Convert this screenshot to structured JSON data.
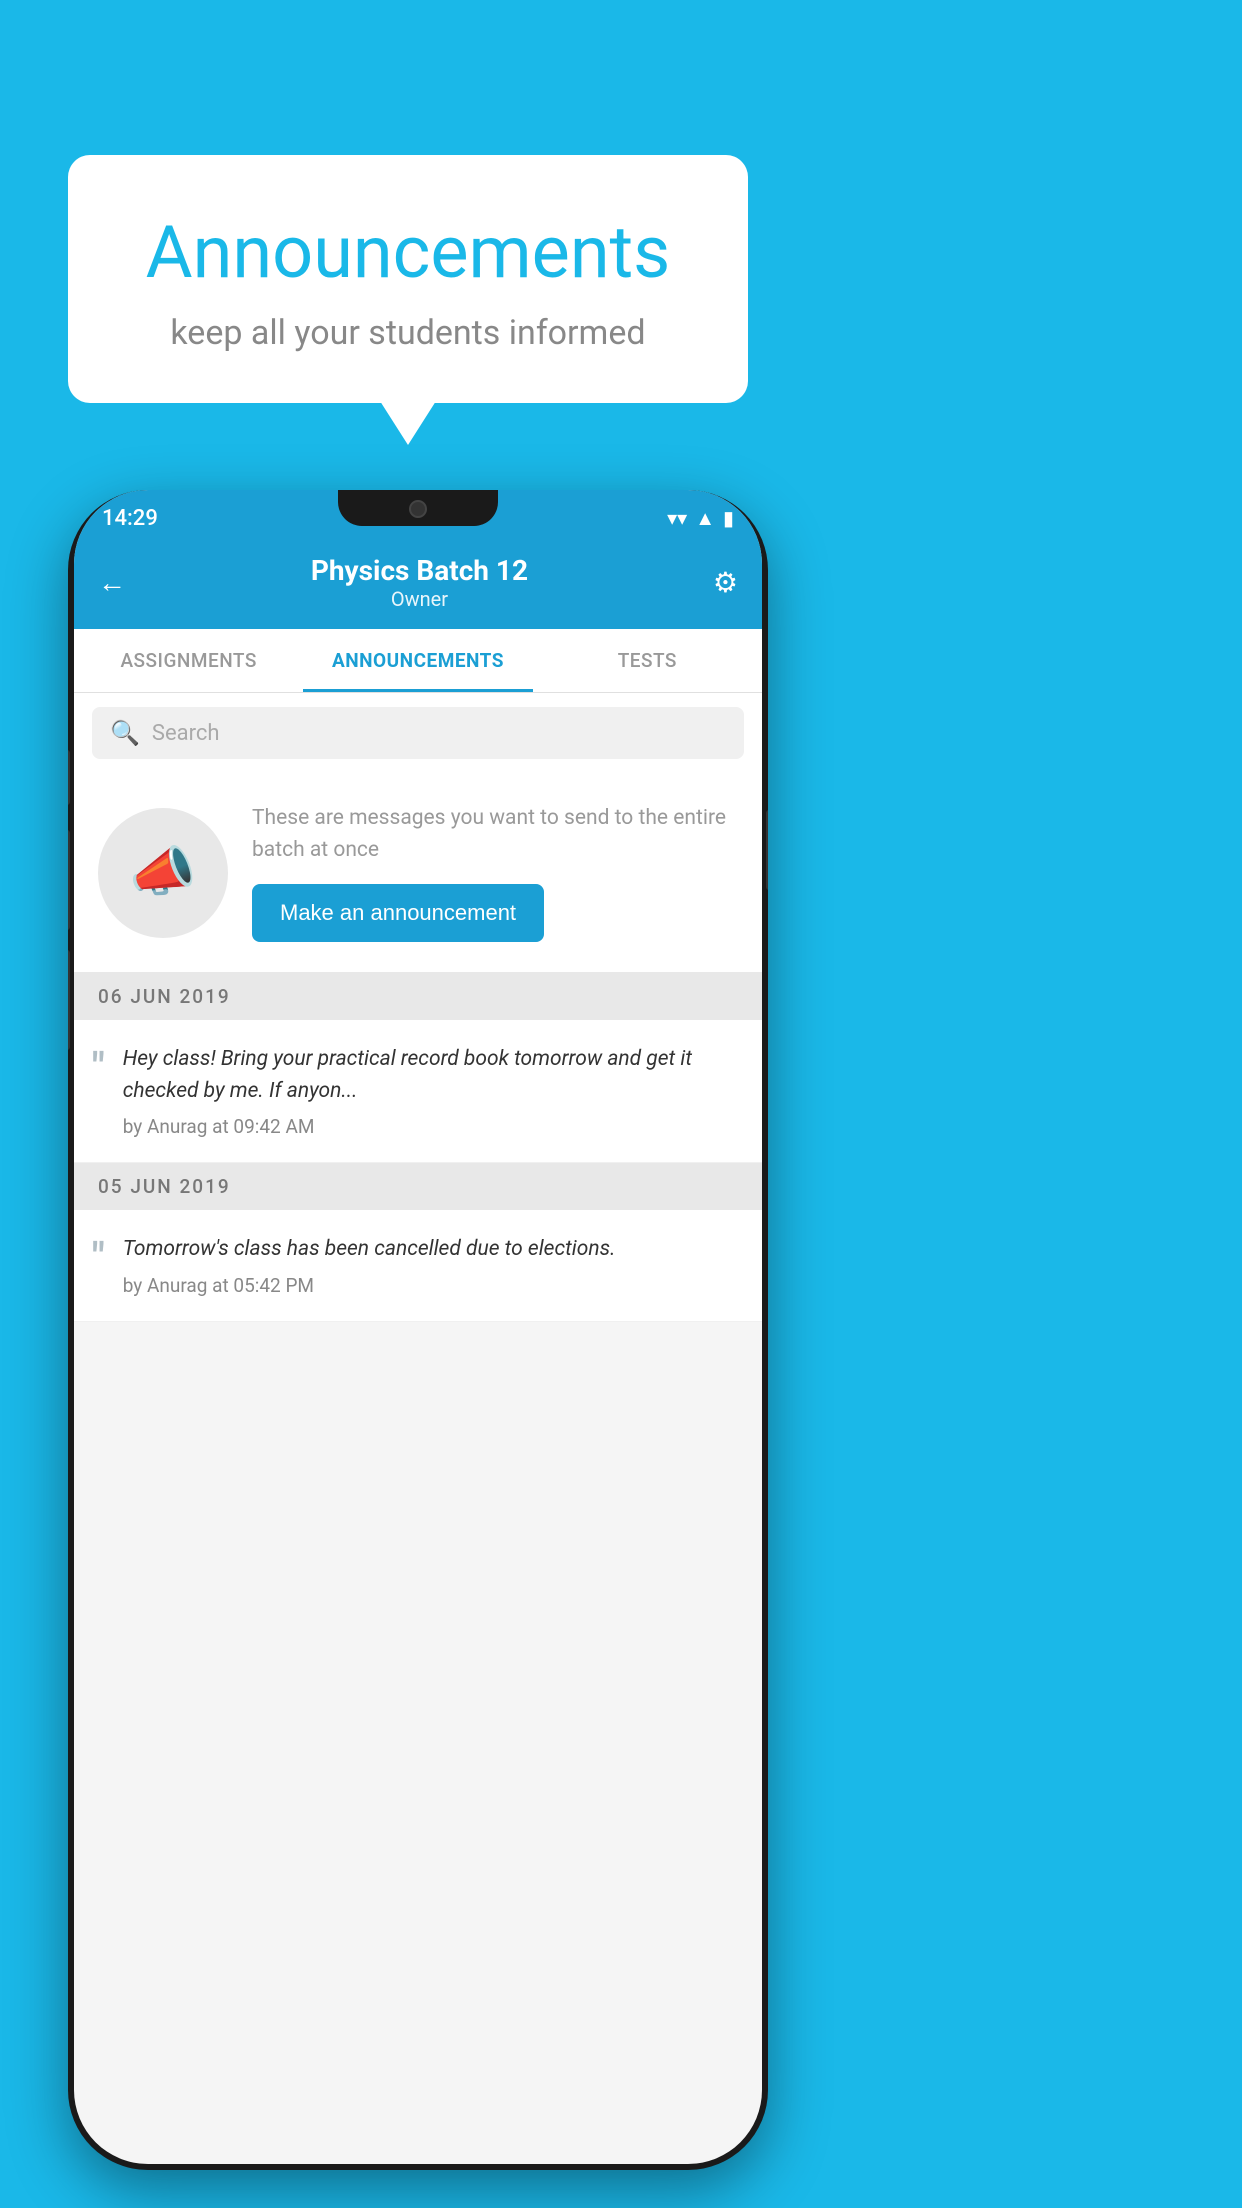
{
  "background_color": "#1ab8e8",
  "speech_bubble": {
    "title": "Announcements",
    "subtitle": "keep all your students informed"
  },
  "phone": {
    "status_bar": {
      "time": "14:29",
      "wifi": "▼",
      "signal": "▲",
      "battery": "▮"
    },
    "header": {
      "title": "Physics Batch 12",
      "subtitle": "Owner",
      "back_label": "←",
      "gear_label": "⚙"
    },
    "tabs": [
      {
        "label": "ASSIGNMENTS",
        "active": false
      },
      {
        "label": "ANNOUNCEMENTS",
        "active": true
      },
      {
        "label": "TESTS",
        "active": false
      }
    ],
    "search": {
      "placeholder": "Search"
    },
    "promo": {
      "description": "These are messages you want to send to the entire batch at once",
      "button_label": "Make an announcement"
    },
    "announcements": [
      {
        "date": "06  JUN  2019",
        "text": "Hey class! Bring your practical record book tomorrow and get it checked by me. If anyon...",
        "meta": "by Anurag at 09:42 AM"
      },
      {
        "date": "05  JUN  2019",
        "text": "Tomorrow's class has been cancelled due to elections.",
        "meta": "by Anurag at 05:42 PM"
      }
    ]
  }
}
